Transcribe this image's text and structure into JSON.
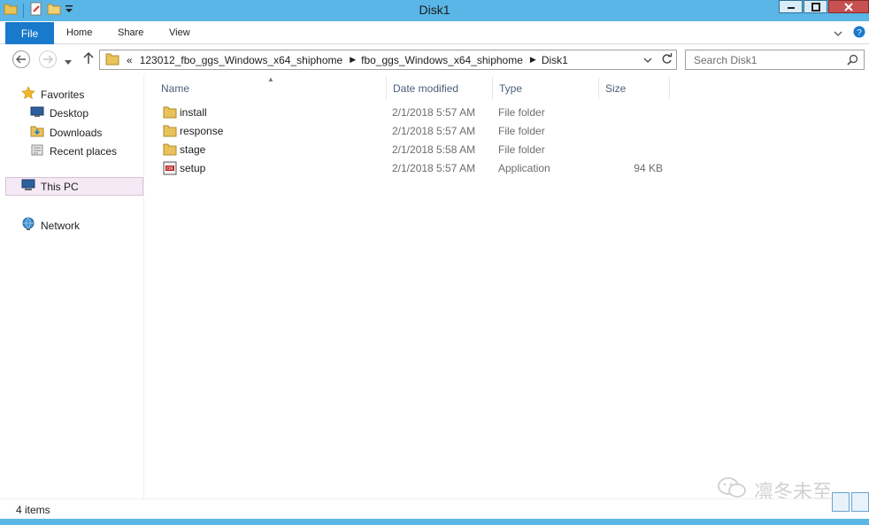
{
  "window": {
    "title": "Disk1"
  },
  "ribbon": {
    "tabs": [
      {
        "label": "File"
      },
      {
        "label": "Home"
      },
      {
        "label": "Share"
      },
      {
        "label": "View"
      }
    ]
  },
  "address": {
    "overflow": "«",
    "crumbs": [
      "123012_fbo_ggs_Windows_x64_shiphome",
      "fbo_ggs_Windows_x64_shiphome",
      "Disk1"
    ]
  },
  "search": {
    "placeholder": "Search Disk1"
  },
  "nav": {
    "favorites": "Favorites",
    "items": [
      "Desktop",
      "Downloads",
      "Recent places"
    ],
    "this_pc": "This PC",
    "network": "Network"
  },
  "columns": [
    "Name",
    "Date modified",
    "Type",
    "Size"
  ],
  "files": [
    {
      "name": "install",
      "date": "2/1/2018 5:57 AM",
      "type": "File folder",
      "size": "",
      "icon": "folder-icon"
    },
    {
      "name": "response",
      "date": "2/1/2018 5:57 AM",
      "type": "File folder",
      "size": "",
      "icon": "folder-icon"
    },
    {
      "name": "stage",
      "date": "2/1/2018 5:58 AM",
      "type": "File folder",
      "size": "",
      "icon": "folder-icon"
    },
    {
      "name": "setup",
      "date": "2/1/2018 5:57 AM",
      "type": "Application",
      "size": "94 KB",
      "icon": "application-icon"
    }
  ],
  "status": {
    "item_count": "4 items"
  },
  "watermark": {
    "text": "凛冬未至"
  },
  "colors": {
    "frame": "#5ab6e6",
    "file_tab": "#1979ca",
    "header_text": "#4c607a",
    "folder": "#e8c25a"
  }
}
